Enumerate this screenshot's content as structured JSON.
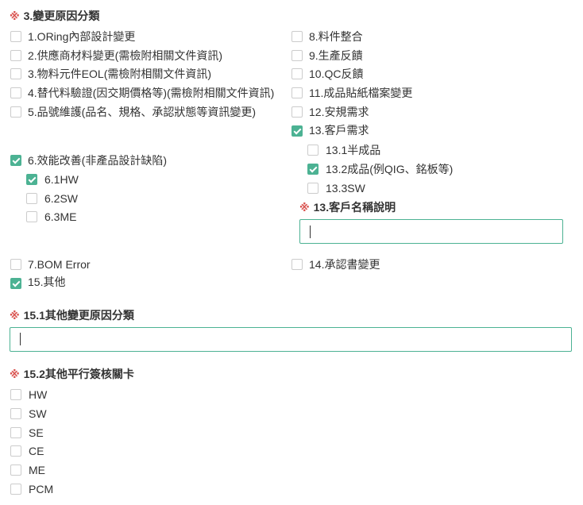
{
  "required_mark": "※",
  "section3": {
    "title": "3.變更原因分類",
    "left": [
      {
        "label": "1.ORing內部設計變更",
        "checked": false
      },
      {
        "label": "2.供應商材料變更(需檢附相關文件資訊)",
        "checked": false
      },
      {
        "label": "3.物料元件EOL(需檢附相關文件資訊)",
        "checked": false
      },
      {
        "label": "4.替代料驗證(因交期價格等)(需檢附相關文件資訊)",
        "checked": false
      },
      {
        "label": "5.品號維護(品名、規格、承認狀態等資訊變更)",
        "checked": false
      },
      {
        "label": "6.效能改善(非產品設計缺陷)",
        "checked": true
      },
      {
        "label": "7.BOM Error",
        "checked": false
      },
      {
        "label": "15.其他",
        "checked": true
      }
    ],
    "sub6": [
      {
        "label": "6.1HW",
        "checked": true
      },
      {
        "label": "6.2SW",
        "checked": false
      },
      {
        "label": "6.3ME",
        "checked": false
      }
    ],
    "right": [
      {
        "label": "8.料件整合",
        "checked": false
      },
      {
        "label": "9.生產反饋",
        "checked": false
      },
      {
        "label": "10.QC反饋",
        "checked": false
      },
      {
        "label": "11.成品貼紙檔案變更",
        "checked": false
      },
      {
        "label": "12.安規需求",
        "checked": false
      },
      {
        "label": "13.客戶需求",
        "checked": true
      },
      {
        "label": "14.承認書變更",
        "checked": false
      }
    ],
    "sub13": [
      {
        "label": "13.1半成品",
        "checked": false
      },
      {
        "label": "13.2成品(例QIG、銘板等)",
        "checked": true
      },
      {
        "label": "13.3SW",
        "checked": false
      }
    ],
    "customer_name": {
      "title": "13.客戶名稱說明",
      "value": ""
    }
  },
  "section15_1": {
    "title": "15.1其他變更原因分類",
    "value": ""
  },
  "section15_2": {
    "title": "15.2其他平行簽核關卡",
    "items": [
      {
        "label": "HW",
        "checked": false
      },
      {
        "label": "SW",
        "checked": false
      },
      {
        "label": "SE",
        "checked": false
      },
      {
        "label": "CE",
        "checked": false
      },
      {
        "label": "ME",
        "checked": false
      },
      {
        "label": "PCM",
        "checked": false
      }
    ]
  }
}
